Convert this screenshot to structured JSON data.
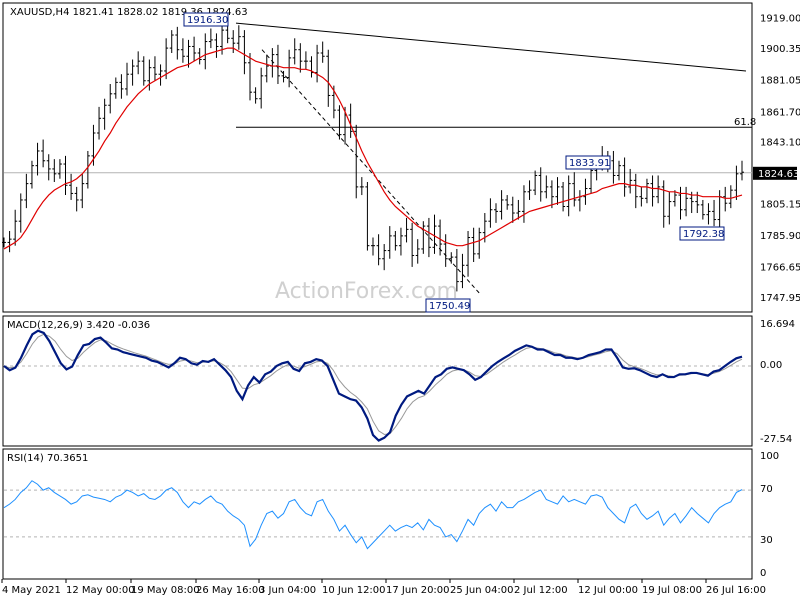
{
  "chart_data": [
    {
      "type": "candlestick",
      "title": "XAUUSD,H4  1821.41 1828.02 1819.36 1824.63",
      "watermark": "ActionForex.com",
      "ylim": [
        1740,
        1928
      ],
      "y_ticks": [
        "1919.00",
        "1900.35",
        "1881.05",
        "1861.70",
        "1843.10",
        "1824.63",
        "1805.15",
        "1785.90",
        "1766.65",
        "1747.95"
      ],
      "current_price": 1824.63,
      "current_price_label": "1824.63",
      "fib_label": "61.8",
      "fib_level": 1852.5,
      "annotations": [
        {
          "text": "1916.30",
          "value": 1916.3
        },
        {
          "text": "1833.91",
          "value": 1833.91
        },
        {
          "text": "1792.38",
          "value": 1792.38
        },
        {
          "text": "1750.49",
          "value": 1750.49
        }
      ],
      "price_series": [
        1782,
        1784,
        1795,
        1808,
        1818,
        1829,
        1838,
        1832,
        1827,
        1824,
        1830,
        1817,
        1812,
        1808,
        1818,
        1835,
        1849,
        1858,
        1866,
        1873,
        1880,
        1876,
        1885,
        1890,
        1893,
        1881,
        1889,
        1885,
        1887,
        1901,
        1909,
        1900,
        1896,
        1902,
        1898,
        1894,
        1905,
        1906,
        1902,
        1912,
        1907,
        1904,
        1908,
        1892,
        1874,
        1870,
        1884,
        1890,
        1897,
        1884,
        1883,
        1895,
        1900,
        1893,
        1893,
        1886,
        1898,
        1896,
        1872,
        1863,
        1848,
        1860,
        1850,
        1816,
        1816,
        1780,
        1780,
        1772,
        1777,
        1786,
        1780,
        1786,
        1790,
        1774,
        1778,
        1792,
        1779,
        1792,
        1781,
        1772,
        1773,
        1758,
        1768,
        1785,
        1775,
        1788,
        1795,
        1802,
        1801,
        1808,
        1805,
        1800,
        1801,
        1813,
        1814,
        1823,
        1813,
        1816,
        1810,
        1816,
        1804,
        1818,
        1808,
        1810,
        1815,
        1826,
        1830,
        1834,
        1832,
        1823,
        1829,
        1816,
        1820,
        1810,
        1809,
        1818,
        1810,
        1816,
        1798,
        1807,
        1811,
        1802,
        1809,
        1807,
        1805,
        1799,
        1801,
        1796,
        1810,
        1806,
        1814,
        1824,
        1825
      ],
      "ma_series": [
        1778,
        1780,
        1782,
        1785,
        1790,
        1796,
        1802,
        1807,
        1811,
        1814,
        1816,
        1818,
        1819,
        1821,
        1824,
        1828,
        1833,
        1838,
        1844,
        1849,
        1855,
        1860,
        1865,
        1869,
        1873,
        1876,
        1879,
        1881,
        1883,
        1885,
        1887,
        1889,
        1890,
        1891,
        1893,
        1895,
        1897,
        1898,
        1899,
        1900,
        1901,
        1901,
        1899,
        1897,
        1895,
        1893,
        1892,
        1891,
        1890,
        1890,
        1889,
        1889,
        1889,
        1888,
        1888,
        1887,
        1885,
        1883,
        1880,
        1875,
        1869,
        1862,
        1854,
        1846,
        1838,
        1831,
        1825,
        1819,
        1813,
        1808,
        1804,
        1801,
        1798,
        1795,
        1792,
        1790,
        1788,
        1786,
        1784,
        1782,
        1781,
        1780,
        1780,
        1781,
        1782,
        1783,
        1785,
        1787,
        1789,
        1791,
        1793,
        1795,
        1797,
        1799,
        1801,
        1802,
        1803,
        1804,
        1805,
        1806,
        1807,
        1808,
        1809,
        1810,
        1811,
        1812,
        1813,
        1815,
        1816,
        1817,
        1818,
        1818,
        1817,
        1817,
        1816,
        1816,
        1815,
        1815,
        1814,
        1813,
        1813,
        1812,
        1812,
        1811,
        1811,
        1810,
        1810,
        1810,
        1810,
        1809,
        1809,
        1810,
        1811
      ]
    },
    {
      "type": "line",
      "title": "MACD(12,26,9) 3.420 -0.036",
      "ylim": [
        -27.54,
        16.694
      ],
      "y_ticks": [
        "16.694",
        "0.00",
        "-27.54"
      ],
      "macd_series": [
        0,
        -1.5,
        -0.6,
        3,
        7.5,
        11.5,
        12.8,
        12,
        9,
        5,
        1,
        -1.2,
        -0.2,
        4,
        7.5,
        8,
        9.8,
        10.3,
        8.5,
        6.4,
        6,
        5,
        4.5,
        4,
        3.5,
        3,
        2,
        1.5,
        0.5,
        -0.5,
        1,
        3,
        2.5,
        1,
        0.5,
        1.8,
        1.5,
        2.5,
        0.5,
        -1.5,
        -4,
        -9,
        -12,
        -7,
        -4,
        -6,
        -3,
        -2,
        0,
        1,
        1.5,
        -1,
        -1.8,
        1,
        1.5,
        2.5,
        2,
        0,
        -5,
        -10,
        -11,
        -12,
        -12.5,
        -15,
        -19,
        -25,
        -27,
        -26,
        -24,
        -18,
        -14,
        -11,
        -10,
        -9,
        -10,
        -7,
        -4,
        -3,
        -1,
        -0.5,
        -1,
        -1.5,
        -3,
        -5,
        -4,
        -2,
        0,
        1.5,
        2.8,
        4,
        5.5,
        6.5,
        7.5,
        7,
        6,
        6,
        5,
        4,
        4,
        3,
        3,
        2.5,
        3,
        4,
        4.5,
        5,
        6,
        6,
        3,
        -0.5,
        -1,
        -0.8,
        -1.5,
        -2.5,
        -3.5,
        -4,
        -3,
        -4,
        -4,
        -3,
        -3,
        -2.5,
        -2.5,
        -3,
        -3.5,
        -2,
        -1.5,
        0,
        1.5,
        2.8,
        3.4
      ],
      "signal_series": [
        0,
        -0.6,
        -0.3,
        1.5,
        4.5,
        8,
        10.5,
        11.5,
        10.8,
        9,
        6,
        3.5,
        2,
        2.8,
        5,
        6.8,
        8.5,
        9.5,
        9.2,
        8,
        7,
        6.2,
        5.5,
        4.8,
        4.2,
        3.6,
        2.8,
        2,
        1.2,
        0.6,
        0.8,
        1.8,
        2.2,
        1.8,
        1.2,
        1.4,
        1.5,
        1.9,
        1.2,
        0,
        -2,
        -5,
        -8,
        -8.2,
        -6.8,
        -6.2,
        -4.8,
        -3.5,
        -1.8,
        -0.5,
        0.5,
        0,
        -0.8,
        -0.2,
        0.6,
        1.5,
        1.8,
        1,
        -1.5,
        -5,
        -7.5,
        -9.5,
        -11,
        -13,
        -15.5,
        -20,
        -23.5,
        -24.8,
        -24.5,
        -22,
        -19,
        -15.5,
        -13,
        -11.5,
        -10.8,
        -9,
        -6.8,
        -5,
        -3,
        -1.8,
        -1.3,
        -1.4,
        -2.2,
        -3.5,
        -3.8,
        -3,
        -1.5,
        0,
        1.5,
        2.8,
        4,
        5.3,
        6.4,
        6.8,
        6.5,
        6.2,
        5.6,
        4.8,
        4.4,
        3.7,
        3.3,
        2.9,
        2.9,
        3.4,
        4,
        4.5,
        5.2,
        5.6,
        4.5,
        2.2,
        0.5,
        -0.2,
        -0.8,
        -1.6,
        -2.5,
        -3.2,
        -3.1,
        -3.5,
        -3.8,
        -3.4,
        -3.2,
        -2.8,
        -2.6,
        -2.8,
        -3.1,
        -2.6,
        -2,
        -1,
        0.2,
        1.5,
        2.5
      ]
    },
    {
      "type": "line",
      "title": "RSI(14) 70.3651",
      "ylim": [
        0,
        100
      ],
      "y_ticks": [
        "100",
        "70",
        "30",
        "0"
      ],
      "levels": [
        70,
        30
      ],
      "rsi_series": [
        55,
        58,
        62,
        68,
        72,
        78,
        75,
        70,
        72,
        68,
        65,
        62,
        58,
        60,
        65,
        66,
        64,
        63,
        62,
        60,
        64,
        66,
        70,
        68,
        65,
        67,
        63,
        62,
        65,
        70,
        72,
        68,
        60,
        55,
        60,
        58,
        62,
        65,
        60,
        58,
        52,
        48,
        45,
        40,
        22,
        28,
        40,
        50,
        52,
        46,
        50,
        60,
        62,
        55,
        50,
        48,
        60,
        62,
        52,
        45,
        35,
        40,
        32,
        25,
        30,
        20,
        25,
        30,
        35,
        40,
        35,
        38,
        40,
        38,
        42,
        36,
        45,
        40,
        38,
        30,
        32,
        26,
        35,
        45,
        40,
        50,
        55,
        58,
        52,
        60,
        55,
        55,
        60,
        62,
        65,
        68,
        70,
        62,
        60,
        58,
        65,
        60,
        62,
        60,
        58,
        65,
        66,
        64,
        55,
        50,
        45,
        42,
        55,
        58,
        50,
        45,
        48,
        52,
        40,
        46,
        50,
        42,
        48,
        55,
        50,
        46,
        42,
        50,
        55,
        58,
        60,
        68,
        70.4
      ]
    }
  ],
  "x_axis_labels": [
    "4 May 2021",
    "12 May 00:00",
    "19 May 08:00",
    "26 May 16:00",
    "3 Jun 04:00",
    "10 Jun 12:00",
    "17 Jun 20:00",
    "25 Jun 04:00",
    "2 Jul 12:00",
    "12 Jul 00:00",
    "19 Jul 08:00",
    "26 Jul 16:00"
  ],
  "colors": {
    "ma": "#e00000",
    "macd": "#001a80",
    "rsi": "#1e90ff",
    "price": "#000000",
    "grid": "#b4b4b4",
    "watermark": "#d0d0d0"
  }
}
